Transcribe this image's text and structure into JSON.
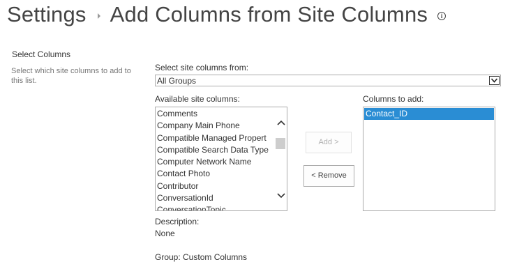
{
  "breadcrumb": {
    "root": "Settings",
    "page": "Add Columns from Site Columns",
    "info_icon": "i"
  },
  "section": {
    "title": "Select Columns",
    "description": "Select which site columns to add to this list."
  },
  "group_select": {
    "label": "Select site columns from:",
    "value": "All Groups"
  },
  "available": {
    "label": "Available site columns:",
    "items": [
      "Comments",
      "Company Main Phone",
      "Compatible Managed Propert",
      "Compatible Search Data Type",
      "Computer Network Name",
      "Contact Photo",
      "Contributor",
      "ConversationId",
      "ConversationTopic"
    ]
  },
  "buttons": {
    "add": "Add >",
    "remove": "< Remove"
  },
  "to_add": {
    "label": "Columns to add:",
    "items": [
      "Contact_ID"
    ]
  },
  "details": {
    "description_label": "Description:",
    "description_value": "None",
    "group_text": "Group: Custom Columns"
  },
  "colors": {
    "selection": "#2a8dd4",
    "text": "#444444"
  }
}
